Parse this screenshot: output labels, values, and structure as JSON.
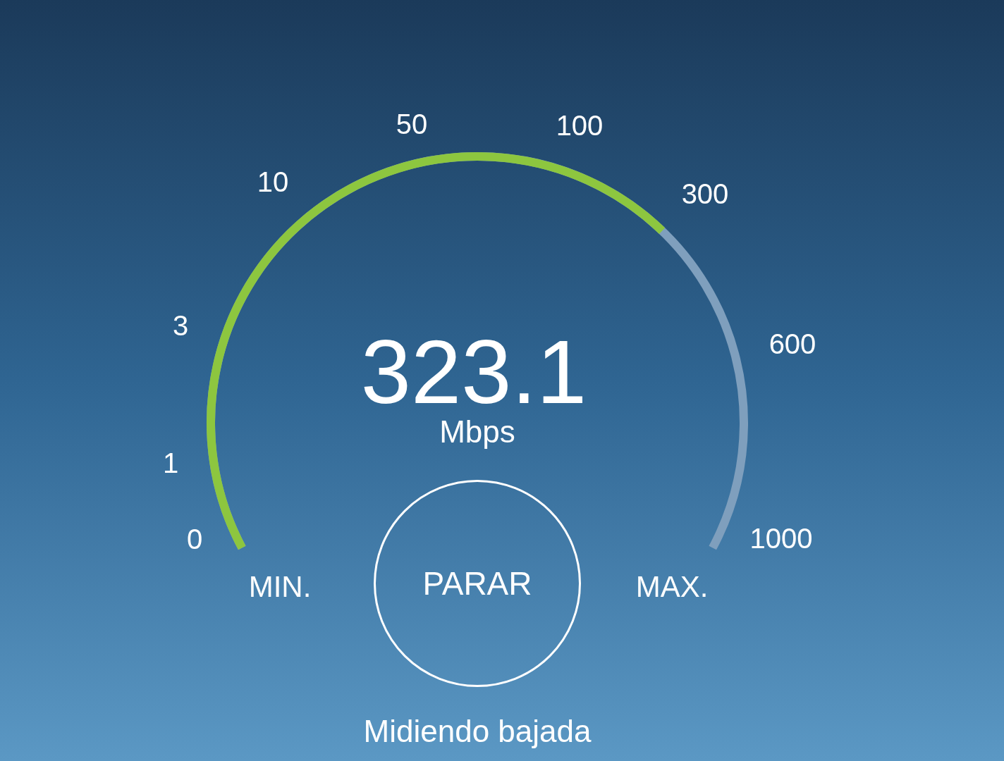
{
  "gauge": {
    "ticks": [
      "0",
      "1",
      "3",
      "10",
      "50",
      "100",
      "300",
      "600",
      "1000"
    ],
    "min_label": "MIN.",
    "max_label": "MAX."
  },
  "reading": {
    "value": "323.1",
    "unit": "Mbps"
  },
  "button": "PARAR",
  "status": "Midiendo bajada"
}
